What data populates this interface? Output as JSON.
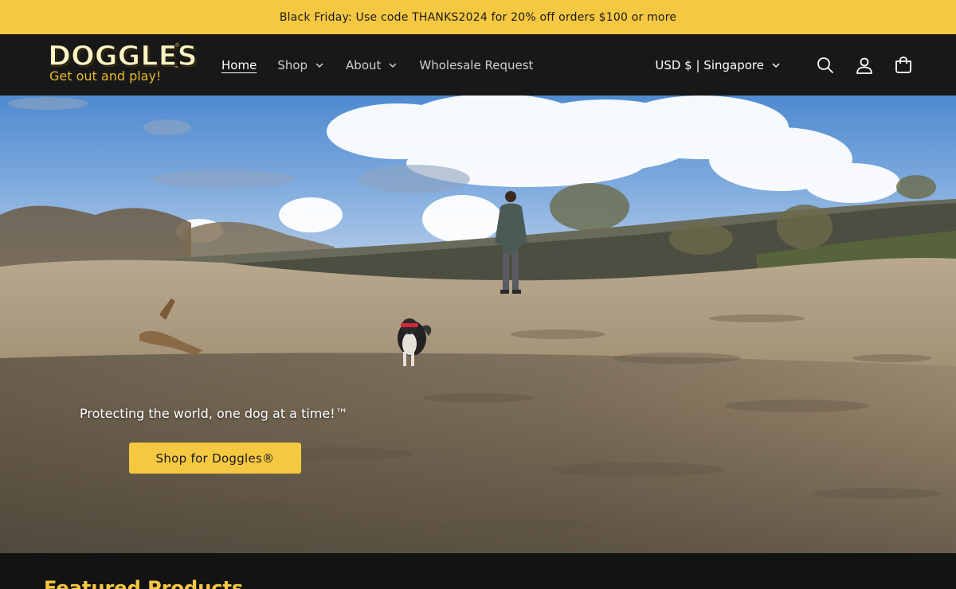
{
  "announcement": {
    "text": "Black Friday: Use code THANKS2024 for 20% off orders $100 or more"
  },
  "brand": {
    "name": "DOGGLES",
    "tagline": "Get out and play!",
    "registered": "®",
    "trademark": "™",
    "accent": "#f5c842"
  },
  "nav": {
    "items": [
      {
        "label": "Home",
        "active": true,
        "has_dropdown": false
      },
      {
        "label": "Shop",
        "active": false,
        "has_dropdown": true
      },
      {
        "label": "About",
        "active": false,
        "has_dropdown": true
      },
      {
        "label": "Wholesale Request",
        "active": false,
        "has_dropdown": false
      }
    ]
  },
  "tools": {
    "locale": "USD $ | Singapore",
    "icons": [
      "search-icon",
      "account-icon",
      "cart-icon"
    ]
  },
  "hero": {
    "tagline": "Protecting the world, one dog at a time!™",
    "cta_label": "Shop for Doggles®"
  },
  "featured": {
    "title": "Featured Products"
  }
}
